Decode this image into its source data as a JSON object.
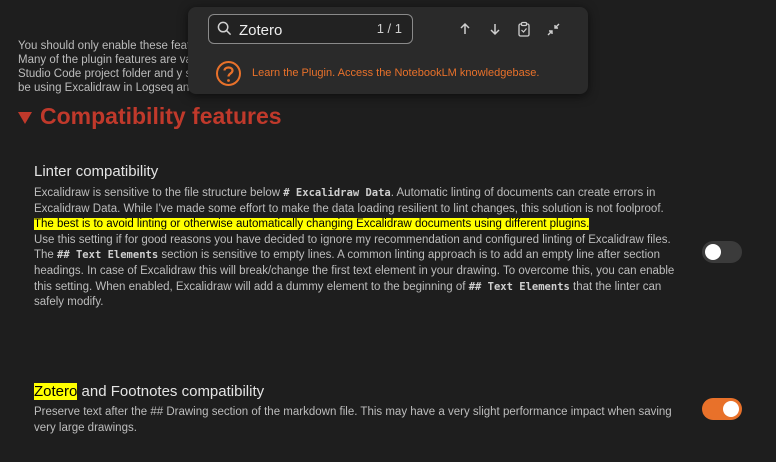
{
  "intro_text": "You should only enable these feat                                                                                                             files instead of markdown files.\nMany of the plugin features are                                                                                                         vault up on top of a Visual\nStudio Code project folder and y                                                                                                       s well. Another usecase might\nbe using Excalidraw in Logseq and Obsidian in parallel.",
  "section": {
    "title": "Compatibility features"
  },
  "linter": {
    "title": "Linter compatibility",
    "p1_before": "Excalidraw is sensitive to the file structure below ",
    "p1_code": "# Excalidraw Data",
    "p1_after": ". Automatic linting of documents can create errors in Excalidraw Data. While I've made some effort to make the data loading resilient to lint changes, this solution is not foolproof.",
    "highlight": "The best is to avoid linting or otherwise automatically changing Excalidraw documents using different plugins.",
    "p2": "Use this setting if for good reasons you have decided to ignore my recommendation and configured linting of Excalidraw files.",
    "p3_before": "The ",
    "p3_code": "## Text Elements",
    "p3_mid": " section is sensitive to empty lines. A common linting approach is to add an empty line after section headings. In case of Excalidraw this will break/change the first text element in your drawing. To overcome this, you can enable this setting. When enabled, Excalidraw will add a dummy element to the beginning of ",
    "p3_code2": "## Text Elements",
    "p3_after": " that the linter can safely modify.",
    "enabled": false
  },
  "zotero": {
    "title_hl": "Zotero",
    "title_rest": " and Footnotes compatibility",
    "desc": "Preserve text after the ## Drawing section of the markdown file. This may have a very slight performance impact when saving very large drawings.",
    "enabled": true
  },
  "search": {
    "query": "Zotero",
    "count": "1 / 1",
    "ai_text": "Learn the Plugin. Access the NotebookLM knowledgebase."
  },
  "colors": {
    "accent": "#e8712a",
    "section": "#c0392b",
    "highlight": "#ffff00"
  }
}
